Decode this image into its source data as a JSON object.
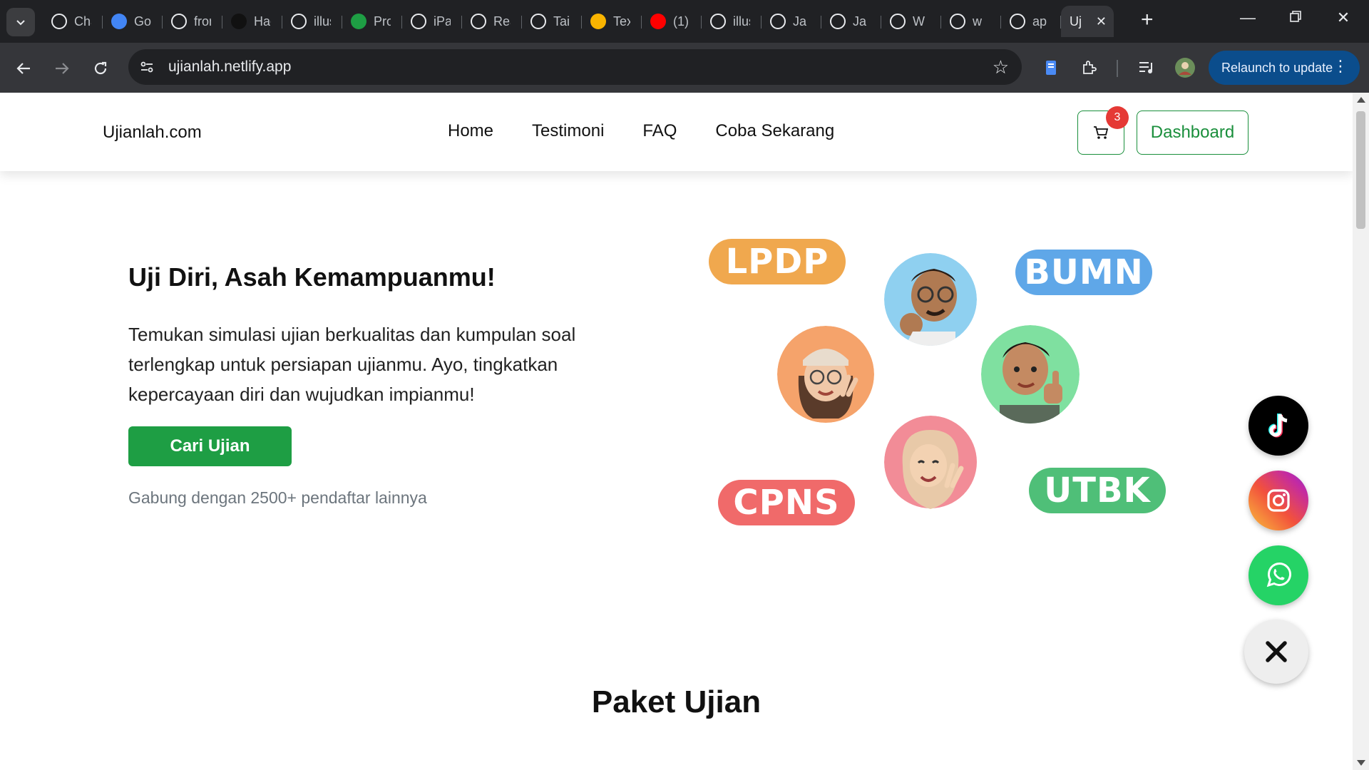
{
  "browser": {
    "tabs": [
      {
        "label": "ChatGPT",
        "icon": "chatgpt-icon",
        "color": "#202124"
      },
      {
        "label": "Google Translate",
        "icon": "google-translate-icon",
        "color": "#4285f4"
      },
      {
        "label": "frontend",
        "icon": "astro-icon",
        "color": "#202124"
      },
      {
        "label": "Hacker",
        "icon": "hacker-icon",
        "color": "#111111"
      },
      {
        "label": "illustrations",
        "icon": "github-icon",
        "color": "#202124"
      },
      {
        "label": "Projects",
        "icon": "project-icon",
        "color": "#1e9e44"
      },
      {
        "label": "iPaymu",
        "icon": "ipaymu-icon",
        "color": "#202124"
      },
      {
        "label": "React",
        "icon": "react-icon",
        "color": "#202124"
      },
      {
        "label": "Tailwind",
        "icon": "tailwind-icon",
        "color": "#202124"
      },
      {
        "label": "Text",
        "icon": "sun-icon",
        "color": "#f9b400"
      },
      {
        "label": "(1)",
        "icon": "youtube-icon",
        "color": "#ff0000"
      },
      {
        "label": "illustrations",
        "icon": "github-icon",
        "color": "#202124"
      },
      {
        "label": "Ja",
        "icon": "w-icon",
        "color": "#202124"
      },
      {
        "label": "Ja",
        "icon": "w-icon",
        "color": "#202124"
      },
      {
        "label": "W",
        "icon": "w-icon",
        "color": "#202124"
      },
      {
        "label": "w",
        "icon": "info-icon",
        "color": "#202124"
      },
      {
        "label": "ap",
        "icon": "diamond-icon",
        "color": "#202124"
      }
    ],
    "active_tab": {
      "label": "Uj"
    },
    "url": "ujianlah.netlify.app",
    "relaunch_label": "Relaunch to update"
  },
  "site": {
    "brand": "Ujianlah.com",
    "nav": [
      "Home",
      "Testimoni",
      "FAQ",
      "Coba Sekarang"
    ],
    "cart_count": "3",
    "dashboard_label": "Dashboard",
    "accent": "#1e9e44"
  },
  "hero": {
    "title": "Uji Diri, Asah Kemampuanmu!",
    "text": "Temukan simulasi ujian berkualitas dan kumpulan soal terlengkap untuk persiapan ujianmu. Ayo, tingkatkan kepercayaan diri dan wujudkan impianmu!",
    "cta": "Cari Ujian",
    "join_text": "Gabung dengan 2500+ pendaftar lainnya",
    "pills": [
      {
        "label": "LPDP",
        "color": "#f0a84e"
      },
      {
        "label": "BUMN",
        "color": "#5fa7e8"
      },
      {
        "label": "CPNS",
        "color": "#f06a6a"
      },
      {
        "label": "UTBK",
        "color": "#4fbf78"
      }
    ]
  },
  "section": {
    "title": "Paket Ujian"
  },
  "floating": {
    "tiktok_color": "#000000",
    "whatsapp_color": "#25d366",
    "close_icon": "close-icon"
  }
}
